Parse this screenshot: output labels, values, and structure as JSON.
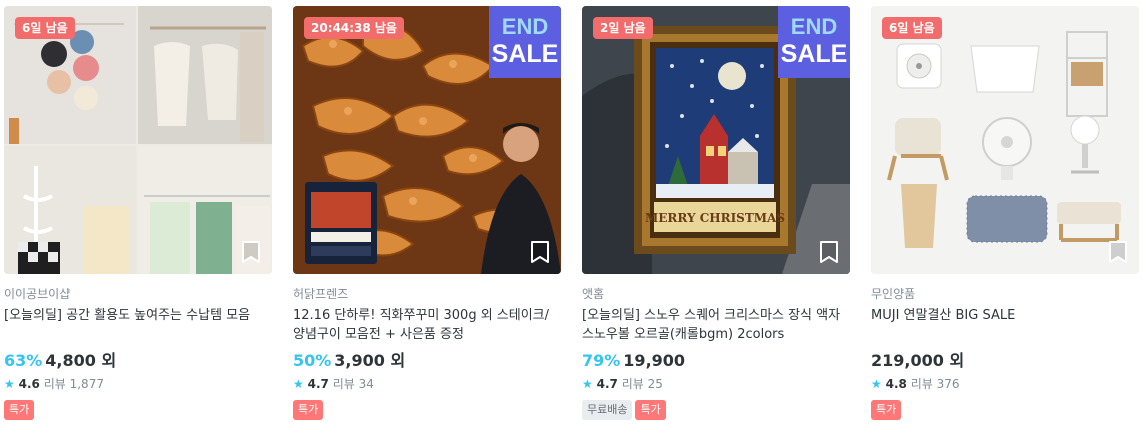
{
  "products": [
    {
      "badge": "6일 남음",
      "end_sale": false,
      "brand": "이이공브이샵",
      "title": "[오늘의딜] 공간 활용도 높여주는 수납템 모음",
      "discount": "63%",
      "price": "4,800 외",
      "rating": "4.6",
      "review_label": "리뷰",
      "review_count": "1,877",
      "tags": [
        {
          "label": "특가",
          "kind": "sale"
        }
      ]
    },
    {
      "badge": "20:44:38 남음",
      "end_sale": true,
      "end_sale_line1": "END",
      "end_sale_line2": "SALE",
      "brand": "허닭프렌즈",
      "title": "12.16 단하루! 직화쭈꾸미 300g 외 스테이크/양념구이 모음전 + 사은품 증정",
      "discount": "50%",
      "price": "3,900 외",
      "rating": "4.7",
      "review_label": "리뷰",
      "review_count": "34",
      "tags": [
        {
          "label": "특가",
          "kind": "sale"
        }
      ]
    },
    {
      "badge": "2일 남음",
      "end_sale": true,
      "end_sale_line1": "END",
      "end_sale_line2": "SALE",
      "image_text": "MERRY CHRISTMAS",
      "brand": "앳홈",
      "title": "[오늘의딜] 스노우 스퀘어 크리스마스 장식 액자 스노우볼 오르골(캐롤bgm) 2colors",
      "discount": "79%",
      "price": "19,900",
      "rating": "4.7",
      "review_label": "리뷰",
      "review_count": "25",
      "tags": [
        {
          "label": "무료배송",
          "kind": "ship"
        },
        {
          "label": "특가",
          "kind": "sale"
        }
      ]
    },
    {
      "badge": "6일 남음",
      "end_sale": false,
      "brand": "무인양품",
      "title": "MUJI 연말결산 BIG SALE",
      "discount": "",
      "price": "219,000 외",
      "rating": "4.8",
      "review_label": "리뷰",
      "review_count": "376",
      "tags": [
        {
          "label": "특가",
          "kind": "sale"
        }
      ]
    }
  ],
  "colors": {
    "discount": "#35c5f0",
    "badge": "#f26c6c",
    "end_sale_bg": "#5b5fe0"
  },
  "icons": {
    "star": "star-icon",
    "bookmark": "bookmark-icon"
  }
}
